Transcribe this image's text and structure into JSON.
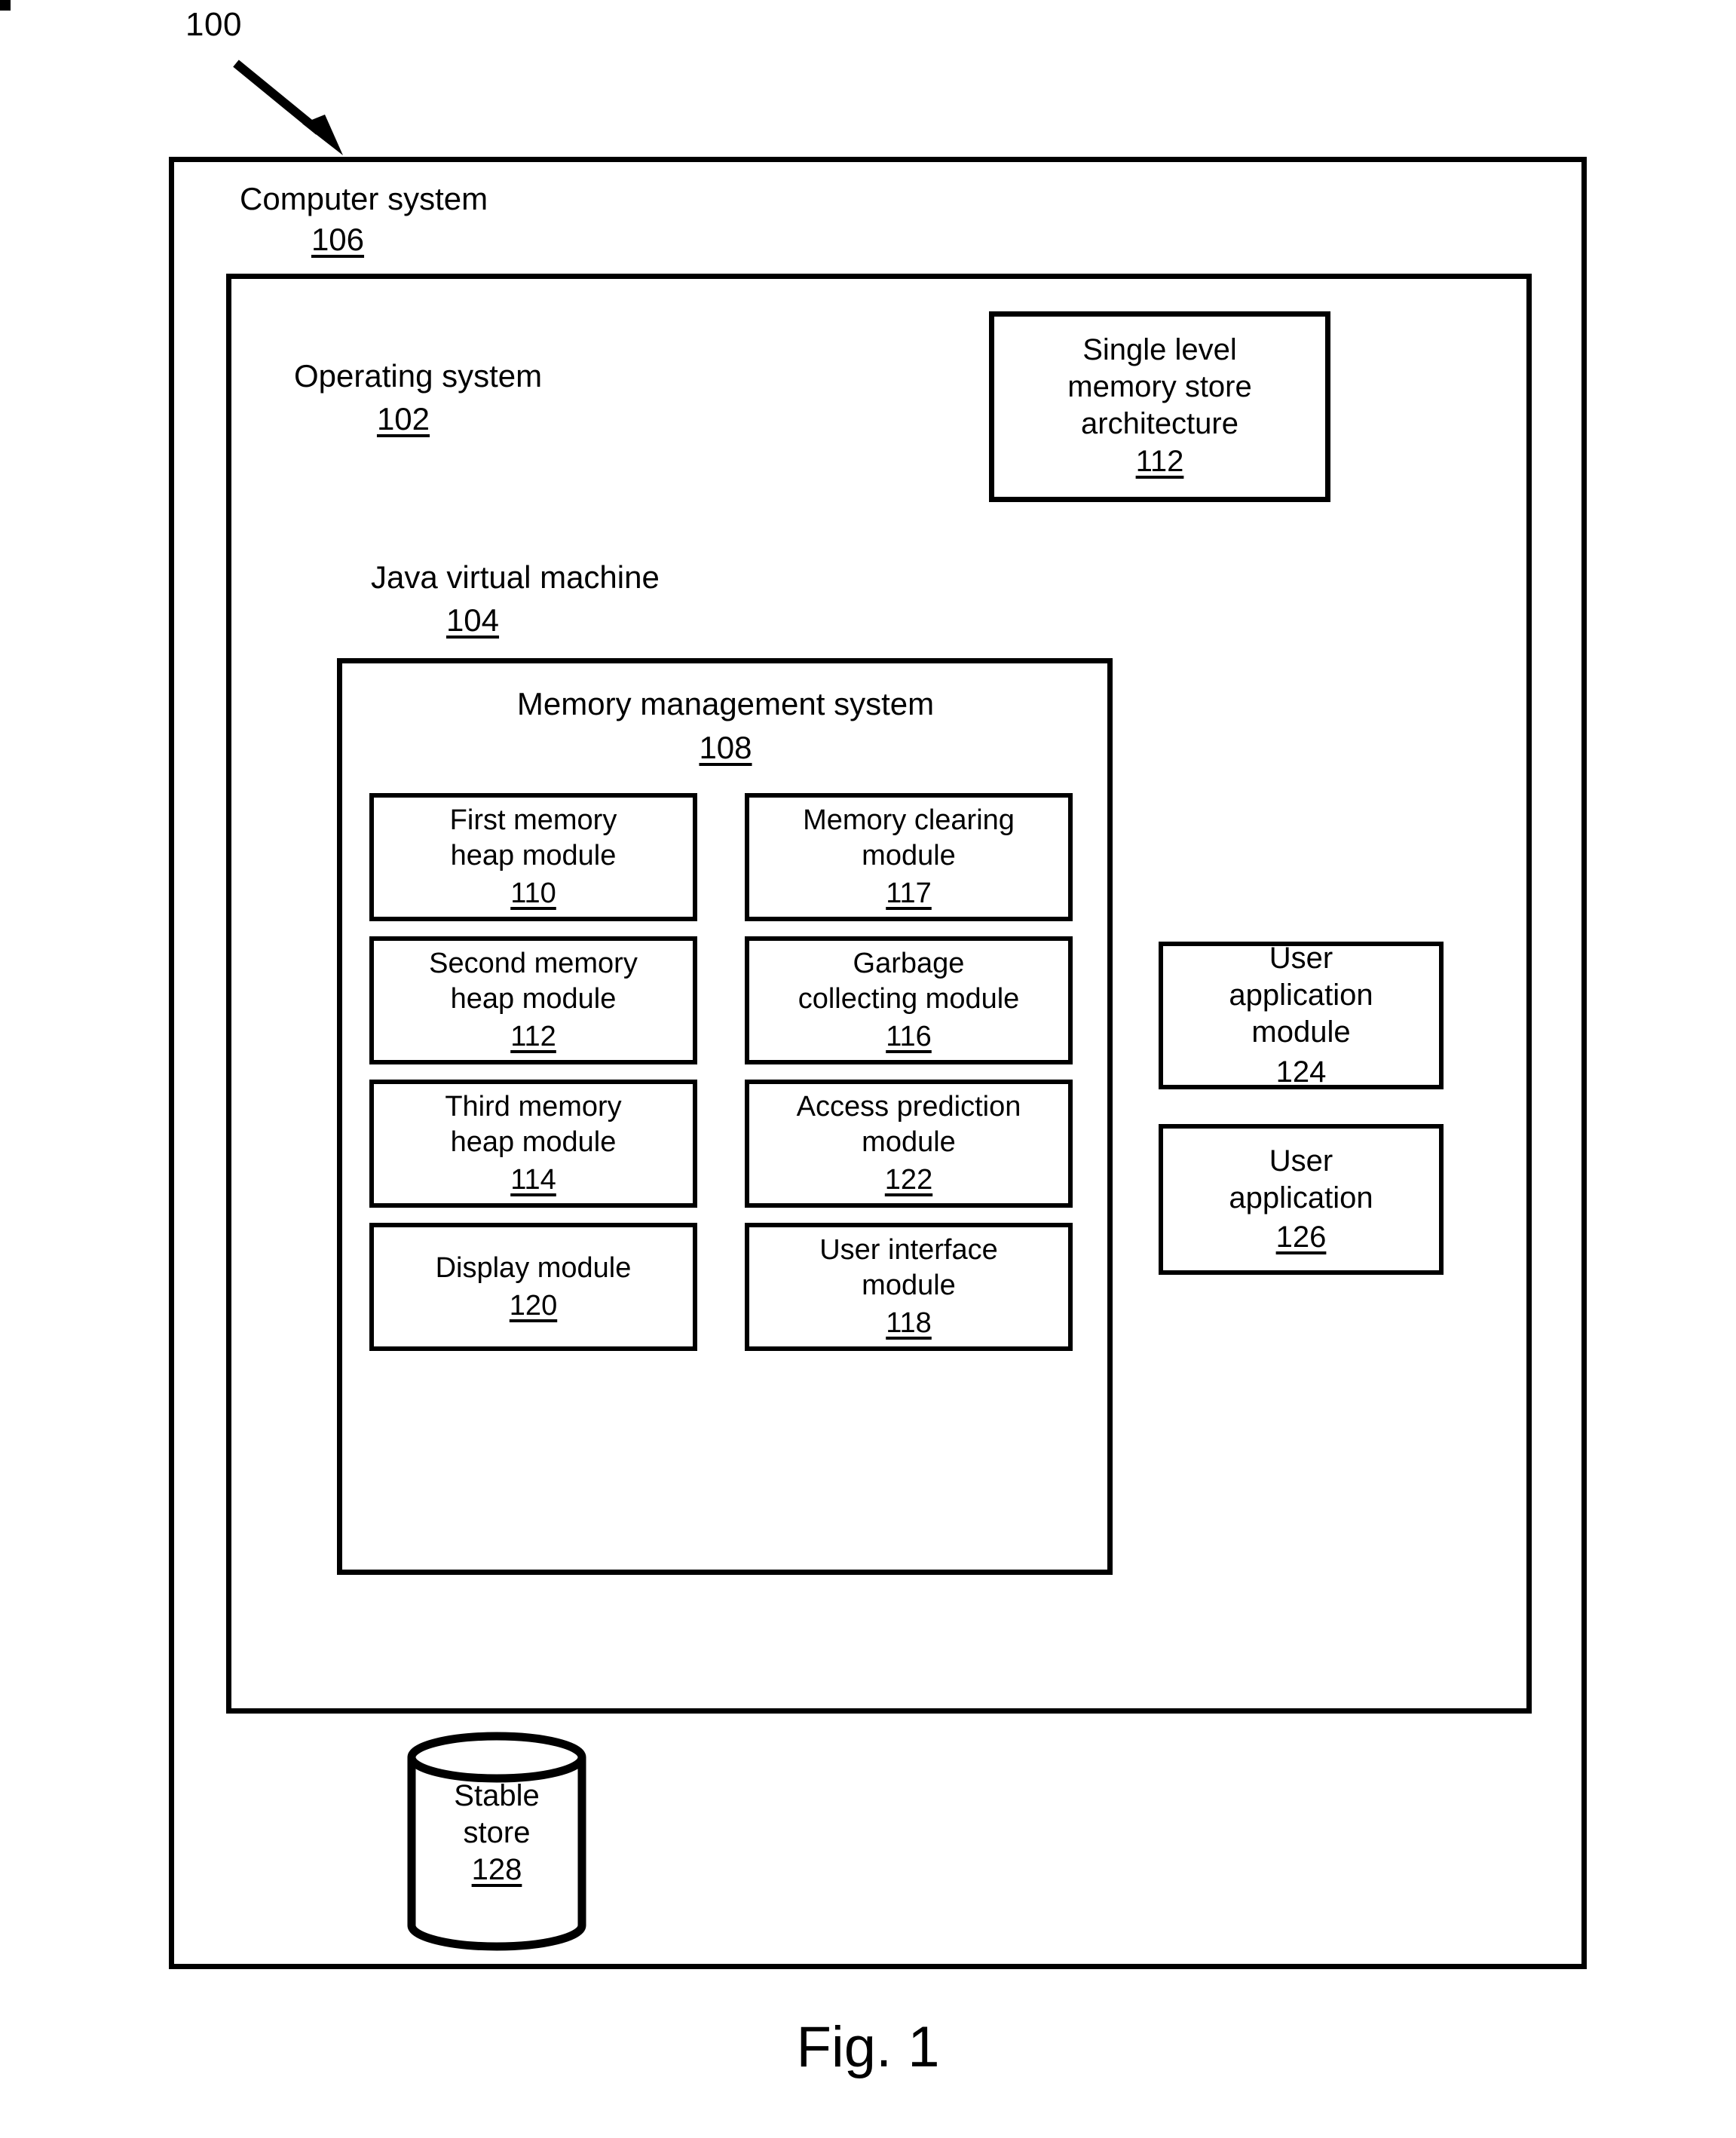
{
  "figure": {
    "callout_number": "100",
    "caption": "Fig. 1"
  },
  "computer_system": {
    "title": "Computer system",
    "ref": "106"
  },
  "operating_system": {
    "title": "Operating system",
    "ref": "102"
  },
  "single_level_memory_store": {
    "title": "Single level\nmemory store\narchitecture",
    "ref": "112"
  },
  "java_virtual_machine": {
    "title": "Java virtual machine",
    "ref": "104"
  },
  "memory_management_system": {
    "title": "Memory management system",
    "ref": "108",
    "modules": [
      {
        "title": "First memory\nheap module",
        "ref": "110"
      },
      {
        "title": "Memory clearing\nmodule",
        "ref": "117"
      },
      {
        "title": "Second memory\nheap module",
        "ref": "112"
      },
      {
        "title": "Garbage\ncollecting module",
        "ref": "116"
      },
      {
        "title": "Third memory\nheap module",
        "ref": "114"
      },
      {
        "title": "Access prediction\nmodule",
        "ref": "122"
      },
      {
        "title": "Display module",
        "ref": "120"
      },
      {
        "title": "User interface\nmodule",
        "ref": "118"
      }
    ]
  },
  "user_applications": [
    {
      "title": "User\napplication\nmodule",
      "ref": "124"
    },
    {
      "title": "User\napplication",
      "ref": "126"
    }
  ],
  "stable_store": {
    "title": "Stable\nstore",
    "ref": "128"
  },
  "colors": {
    "stroke": "#000000",
    "background": "#ffffff"
  }
}
